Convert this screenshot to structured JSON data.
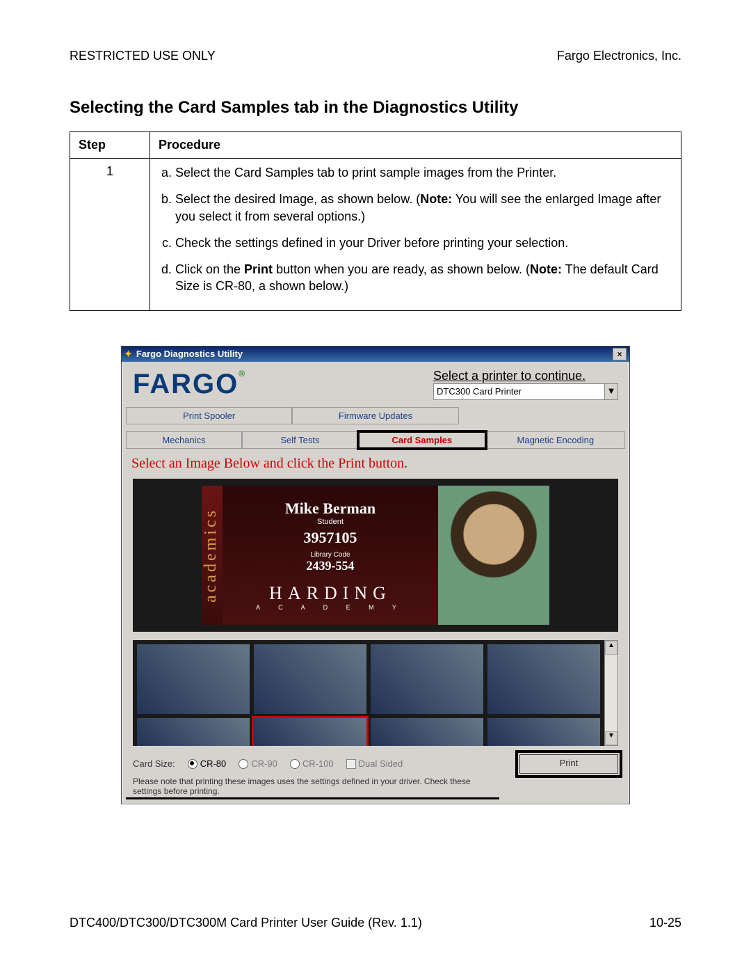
{
  "header": {
    "left": "RESTRICTED USE ONLY",
    "right": "Fargo Electronics, Inc."
  },
  "title": "Selecting the Card Samples tab in the Diagnostics Utility",
  "table": {
    "headers": {
      "step": "Step",
      "procedure": "Procedure"
    },
    "step_num": "1",
    "items": {
      "a": "Select the Card Samples tab to print sample images from the Printer.",
      "b_pre": "Select the desired Image, as shown below. (",
      "b_note": "Note:",
      "b_post": "  You will see the enlarged Image after you select it from several options.)",
      "c": "Check the settings defined in your Driver before printing your selection.",
      "d_pre": "Click on the ",
      "d_btn": "Print",
      "d_mid": " button when you are ready, as shown below. (",
      "d_note": "Note:",
      "d_post": "  The default Card Size is CR-80, a shown below.)"
    }
  },
  "window": {
    "titlebar": "Fargo Diagnostics Utility",
    "logo": "FARGO",
    "logo_mark": "®",
    "select_label": "Select a printer to continue.",
    "printer": "DTC300 Card Printer",
    "tabs": {
      "r1c1": "Print Spooler",
      "r1c2": "Firmware Updates",
      "r1c3": "",
      "r2c1": "Mechanics",
      "r2c2": "Self Tests",
      "active": "Card Samples",
      "r2c4": "Magnetic Encoding"
    },
    "red_heading": "Select an Image Below and click the Print button.",
    "card": {
      "side": "academics",
      "name": "Mike Berman",
      "role": "Student",
      "number": "3957105",
      "lib_label": "Library Code",
      "lib_code": "2439-554",
      "school": "HARDING",
      "school_sub": "A C A D E M Y"
    },
    "sizes": {
      "label": "Card Size:",
      "cr80": "CR-80",
      "cr90": "CR-90",
      "cr100": "CR-100",
      "dual": "Dual Sided"
    },
    "print": "Print",
    "note": "Please note that printing these images uses the settings defined in your driver. Check these settings before printing."
  },
  "footer": {
    "left": "DTC400/DTC300/DTC300M Card Printer User Guide (Rev. 1.1)",
    "right": "10-25"
  }
}
